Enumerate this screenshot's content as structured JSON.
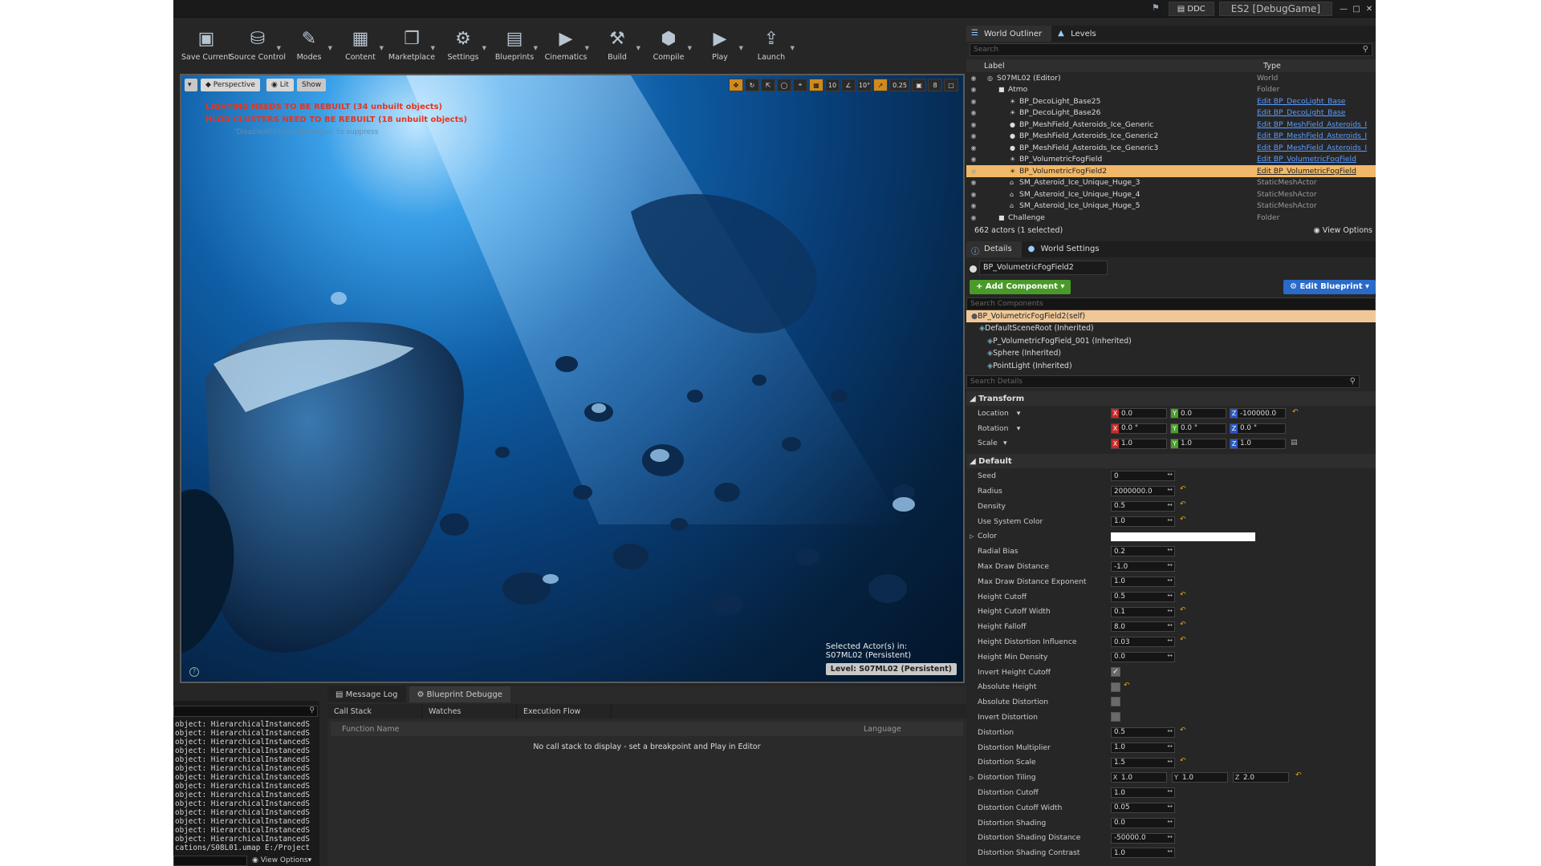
{
  "titlebar": {
    "ddc": "DDC",
    "project": "ES2 [DebugGame]"
  },
  "toolbar": [
    {
      "label": "Save Current",
      "icon": "save-icon"
    },
    {
      "label": "Source Control",
      "icon": "source-control-icon"
    },
    {
      "label": "Modes",
      "icon": "modes-icon"
    },
    {
      "label": "Content",
      "icon": "content-icon"
    },
    {
      "label": "Marketplace",
      "icon": "marketplace-icon"
    },
    {
      "label": "Settings",
      "icon": "settings-icon"
    },
    {
      "label": "Blueprints",
      "icon": "blueprints-icon"
    },
    {
      "label": "Cinematics",
      "icon": "cinematics-icon"
    },
    {
      "label": "Build",
      "icon": "build-icon"
    },
    {
      "label": "Compile",
      "icon": "compile-icon"
    },
    {
      "label": "Play",
      "icon": "play-icon"
    },
    {
      "label": "Launch",
      "icon": "launch-icon"
    }
  ],
  "viewport": {
    "perspective": "Perspective",
    "lit": "Lit",
    "show": "Show",
    "grid_snap": "10",
    "angle_snap": "10°",
    "scale_snap": "0.25",
    "cam_speed": "8",
    "warning1": "LIGHTING NEEDS TO BE REBUILT (34 unbuilt objects)",
    "warning2": "HLOD CLUSTERS NEED TO BE REBUILT (18 unbuilt objects)",
    "suppress": "'DisableAllScreenMessages' to suppress",
    "selected_label": "Selected Actor(s) in:",
    "selected_level": "S07ML02 (Persistent)",
    "level_badge": "Level:  S07ML02 (Persistent)"
  },
  "output_log": {
    "lines": [
      "object: HierarchicalInstancedS",
      "object: HierarchicalInstancedS",
      "object: HierarchicalInstancedS",
      "object: HierarchicalInstancedS",
      "object: HierarchicalInstancedS",
      "object: HierarchicalInstancedS",
      "object: HierarchicalInstancedS",
      "object: HierarchicalInstancedS",
      "object: HierarchicalInstancedS",
      "object: HierarchicalInstancedS",
      "object: HierarchicalInstancedS",
      "object: HierarchicalInstancedS",
      "object: HierarchicalInstancedS",
      "object: HierarchicalInstancedS",
      "cations/S08L01.umap E:/Project"
    ],
    "view_options": "View Options"
  },
  "debugger": {
    "tab_message_log": "Message Log",
    "tab_blueprint": "Blueprint Debugge",
    "call_stack": "Call Stack",
    "watches": "Watches",
    "execution_flow": "Execution Flow",
    "col_function": "Function Name",
    "col_language": "Language",
    "empty_msg": "No call stack to display - set a breakpoint and Play in Editor"
  },
  "outliner": {
    "tab1": "World Outliner",
    "tab2": "Levels",
    "search_placeholder": "Search",
    "col_label": "Label",
    "col_type": "Type",
    "rows": [
      {
        "indent": 0,
        "label": "S07ML02 (Editor)",
        "type": "World",
        "link": false,
        "sel": false,
        "icon": "world-icon"
      },
      {
        "indent": 1,
        "label": "Atmo",
        "type": "Folder",
        "link": false,
        "sel": false,
        "icon": "folder-icon"
      },
      {
        "indent": 2,
        "label": "BP_DecoLight_Base25",
        "type": "Edit BP_DecoLight_Base",
        "link": true,
        "sel": false,
        "icon": "light-icon"
      },
      {
        "indent": 2,
        "label": "BP_DecoLight_Base26",
        "type": "Edit BP_DecoLight_Base",
        "link": true,
        "sel": false,
        "icon": "light-icon"
      },
      {
        "indent": 2,
        "label": "BP_MeshField_Asteroids_Ice_Generic",
        "type": "Edit BP_MeshField_Asteroids_I",
        "link": true,
        "sel": false,
        "icon": "actor-icon"
      },
      {
        "indent": 2,
        "label": "BP_MeshField_Asteroids_Ice_Generic2",
        "type": "Edit BP_MeshField_Asteroids_I",
        "link": true,
        "sel": false,
        "icon": "actor-icon"
      },
      {
        "indent": 2,
        "label": "BP_MeshField_Asteroids_Ice_Generic3",
        "type": "Edit BP_MeshField_Asteroids_I",
        "link": true,
        "sel": false,
        "icon": "actor-icon"
      },
      {
        "indent": 2,
        "label": "BP_VolumetricFogField",
        "type": "Edit BP_VolumetricFogField",
        "link": true,
        "sel": false,
        "icon": "light-icon"
      },
      {
        "indent": 2,
        "label": "BP_VolumetricFogField2",
        "type": "Edit BP_VolumetricFogField",
        "link": true,
        "sel": true,
        "icon": "light-icon"
      },
      {
        "indent": 2,
        "label": "SM_Asteroid_Ice_Unique_Huge_3",
        "type": "StaticMeshActor",
        "link": false,
        "sel": false,
        "icon": "mesh-icon"
      },
      {
        "indent": 2,
        "label": "SM_Asteroid_Ice_Unique_Huge_4",
        "type": "StaticMeshActor",
        "link": false,
        "sel": false,
        "icon": "mesh-icon"
      },
      {
        "indent": 2,
        "label": "SM_Asteroid_Ice_Unique_Huge_5",
        "type": "StaticMeshActor",
        "link": false,
        "sel": false,
        "icon": "mesh-icon"
      },
      {
        "indent": 1,
        "label": "Challenge",
        "type": "Folder",
        "link": false,
        "sel": false,
        "icon": "folder-icon"
      }
    ],
    "footer_count": "662 actors (1 selected)",
    "view_options": "View Options"
  },
  "details": {
    "tab1": "Details",
    "tab2": "World Settings",
    "name": "BP_VolumetricFogField2",
    "add_component": "+ Add Component",
    "edit_blueprint": "Edit Blueprint",
    "search_components": "Search Components",
    "components": [
      {
        "indent": 0,
        "label": "BP_VolumetricFogField2(self)",
        "sel": true
      },
      {
        "indent": 1,
        "label": "DefaultSceneRoot (Inherited)",
        "sel": false
      },
      {
        "indent": 2,
        "label": "P_VolumetricFogField_001 (Inherited)",
        "sel": false
      },
      {
        "indent": 2,
        "label": "Sphere (Inherited)",
        "sel": false
      },
      {
        "indent": 2,
        "label": "PointLight (Inherited)",
        "sel": false
      }
    ],
    "search_details": "Search Details",
    "transform_title": "Transform",
    "transform": [
      {
        "label": "Location",
        "x": "0.0",
        "y": "0.0",
        "z": "-100000.0",
        "reset": true
      },
      {
        "label": "Rotation",
        "x": "0.0 °",
        "y": "0.0 °",
        "z": "0.0 °",
        "reset": false
      },
      {
        "label": "Scale",
        "x": "1.0",
        "y": "1.0",
        "z": "1.0",
        "reset": false
      }
    ],
    "default_title": "Default",
    "props": [
      {
        "label": "Seed",
        "kind": "num",
        "value": "0",
        "reset": false
      },
      {
        "label": "Radius",
        "kind": "num",
        "value": "2000000.0",
        "reset": true
      },
      {
        "label": "Density",
        "kind": "num",
        "value": "0.5",
        "reset": true
      },
      {
        "label": "Use System Color",
        "kind": "num",
        "value": "1.0",
        "reset": true
      },
      {
        "label": "Color",
        "kind": "color",
        "value": "",
        "reset": false
      },
      {
        "label": "Radial Bias",
        "kind": "num",
        "value": "0.2",
        "reset": false
      },
      {
        "label": "Max Draw Distance",
        "kind": "num",
        "value": "-1.0",
        "reset": false
      },
      {
        "label": "Max Draw Distance Exponent",
        "kind": "num",
        "value": "1.0",
        "reset": false
      },
      {
        "label": "Height Cutoff",
        "kind": "num",
        "value": "0.5",
        "reset": true
      },
      {
        "label": "Height Cutoff Width",
        "kind": "num",
        "value": "0.1",
        "reset": true
      },
      {
        "label": "Height Falloff",
        "kind": "num",
        "value": "8.0",
        "reset": true
      },
      {
        "label": "Height Distortion Influence",
        "kind": "num",
        "value": "0.03",
        "reset": true
      },
      {
        "label": "Height Min Density",
        "kind": "num",
        "value": "0.0",
        "reset": false
      },
      {
        "label": "Invert Height Cutoff",
        "kind": "check",
        "value": "✓",
        "reset": false
      },
      {
        "label": "Absolute Height",
        "kind": "check",
        "value": "",
        "reset": true
      },
      {
        "label": "Absolute Distortion",
        "kind": "check",
        "value": "",
        "reset": false
      },
      {
        "label": "Invert Distortion",
        "kind": "check",
        "value": "",
        "reset": false
      },
      {
        "label": "Distortion",
        "kind": "num",
        "value": "0.5",
        "reset": true
      },
      {
        "label": "Distortion Multiplier",
        "kind": "num",
        "value": "1.0",
        "reset": false
      },
      {
        "label": "Distortion Scale",
        "kind": "num",
        "value": "1.5",
        "reset": true
      },
      {
        "label": "Distortion Tiling",
        "kind": "vec",
        "x": "1.0",
        "y": "1.0",
        "z": "2.0",
        "reset": true
      },
      {
        "label": "Distortion Cutoff",
        "kind": "num",
        "value": "1.0",
        "reset": false
      },
      {
        "label": "Distortion Cutoff Width",
        "kind": "num",
        "value": "0.05",
        "reset": false
      },
      {
        "label": "Distortion Shading",
        "kind": "num",
        "value": "0.0",
        "reset": false
      },
      {
        "label": "Distortion Shading Distance",
        "kind": "num",
        "value": "-50000.0",
        "reset": false
      },
      {
        "label": "Distortion Shading Contrast",
        "kind": "num",
        "value": "1.0",
        "reset": false
      }
    ]
  }
}
